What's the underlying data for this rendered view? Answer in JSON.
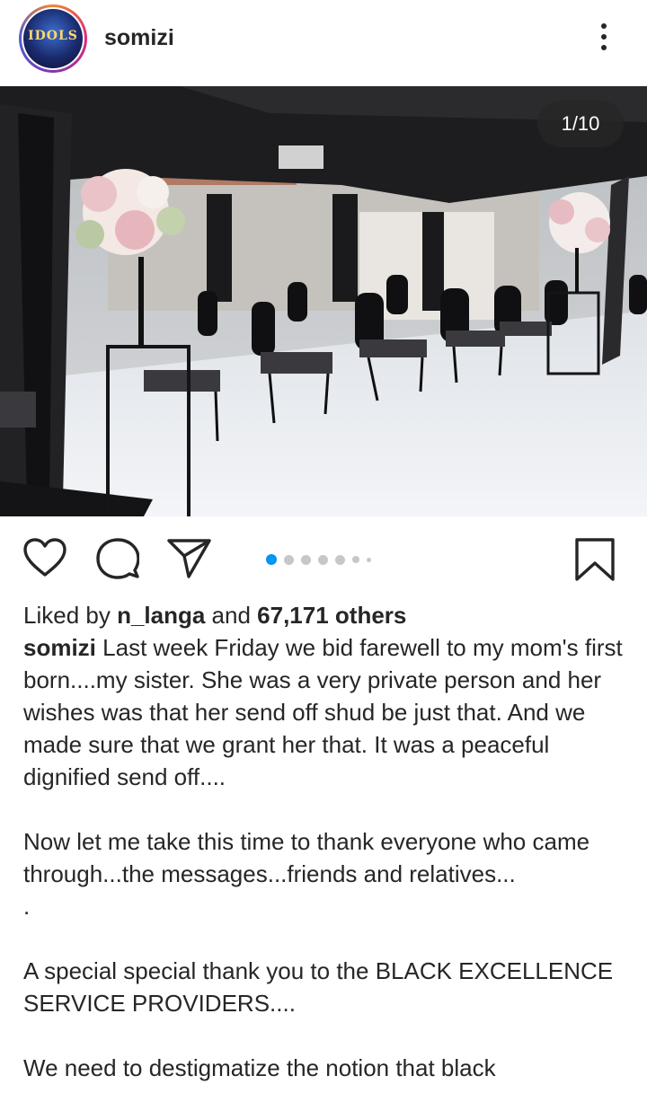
{
  "post": {
    "username": "somizi",
    "avatar_text": "IDOLS",
    "counter": "1/10",
    "carousel": {
      "total": 7,
      "active_index": 0
    }
  },
  "likes": {
    "prefix": "Liked by ",
    "user": "n_langa",
    "middle": " and ",
    "count_text": "67,171 others"
  },
  "caption": {
    "author": "somizi",
    "paragraphs": [
      " Last week Friday we bid farewell to my mom's first born....my sister. She was a very private person and her wishes was that her send off shud be just that.  And we made sure that we grant her that. It was a peaceful dignified send off....",
      "",
      "Now let me take this time to thank everyone who came through...the messages...friends and relatives...",
      ".",
      "",
      "A special special thank you to the BLACK EXCELLENCE SERVICE PROVIDERS....",
      "",
      "We need to destigmatize the notion that black"
    ]
  },
  "colors": {
    "text": "#262626",
    "dot_active": "#0095f6",
    "dot_inactive": "#c7c7c7"
  },
  "icons": {
    "like": "heart-icon",
    "comment": "comment-icon",
    "share": "send-icon",
    "save": "bookmark-icon",
    "more": "more-vertical-icon"
  }
}
